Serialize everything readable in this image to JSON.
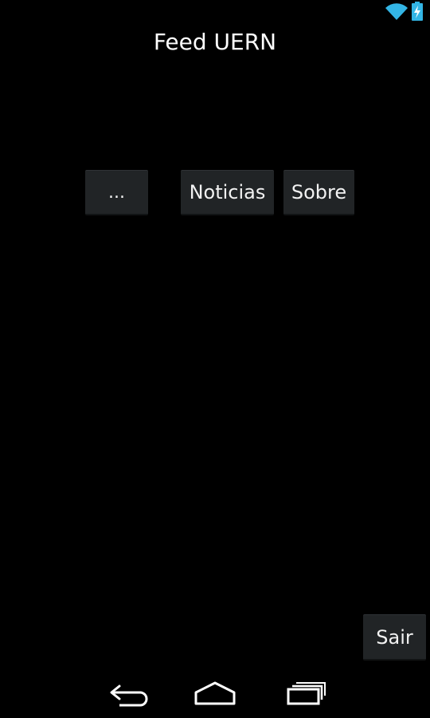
{
  "status_bar": {
    "icons": [
      "wifi-icon",
      "battery-charging-icon"
    ],
    "accent_color": "#33b5e5"
  },
  "app": {
    "title": "Feed UERN"
  },
  "buttons": {
    "more_label": "...",
    "news_label": "Noticias",
    "about_label": "Sobre",
    "exit_label": "Sair"
  },
  "navigation": {
    "icons": [
      "back-icon",
      "home-icon",
      "recent-apps-icon"
    ]
  },
  "colors": {
    "background": "#000000",
    "button_bg": "#212426",
    "text": "#ffffff"
  }
}
